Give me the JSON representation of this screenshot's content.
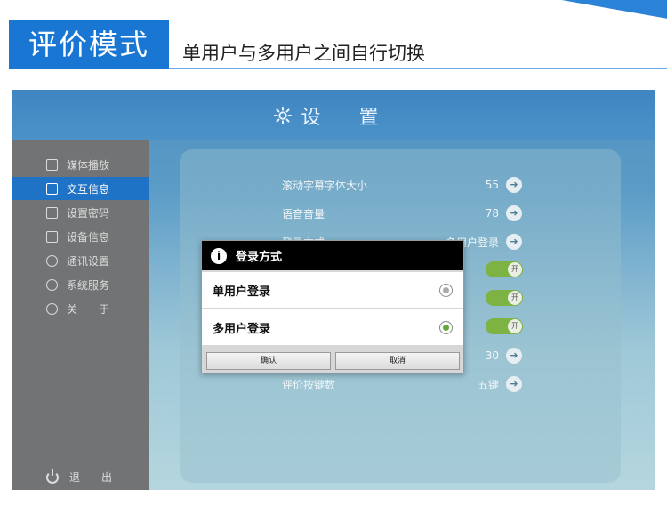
{
  "banner": {
    "title": "评价模式",
    "subtitle": "单用户与多用户之间自行切换"
  },
  "app": {
    "header_title": "设 置",
    "sidebar": {
      "items": [
        {
          "label": "媒体播放",
          "icon": "play-icon"
        },
        {
          "label": "交互信息",
          "icon": "document-icon"
        },
        {
          "label": "设置密码",
          "icon": "lock-icon"
        },
        {
          "label": "设备信息",
          "icon": "device-info-icon"
        },
        {
          "label": "通讯设置",
          "icon": "globe-icon"
        },
        {
          "label": "系统服务",
          "icon": "wrench-icon"
        },
        {
          "label": "关　　于",
          "icon": "info-icon"
        }
      ],
      "active_index": 1,
      "exit_label": "退　　出"
    },
    "settings": [
      {
        "label": "滚动字幕字体大小",
        "value": "55"
      },
      {
        "label": "语音音量",
        "value": "78"
      },
      {
        "label": "登录方式",
        "value": "多用户登录"
      },
      {
        "label": "",
        "value": "开"
      },
      {
        "label": "",
        "value": "开"
      },
      {
        "label": "",
        "value": "开"
      },
      {
        "label": "",
        "value": "30"
      },
      {
        "label": "评价按键数",
        "value": "五键"
      }
    ],
    "dialog": {
      "title": "登录方式",
      "options": [
        {
          "label": "单用户登录",
          "selected": false
        },
        {
          "label": "多用户登录",
          "selected": true
        }
      ],
      "confirm_label": "确认",
      "cancel_label": "取消"
    }
  },
  "colors": {
    "accent": "#1976d2",
    "sidebar_bg": "#717374",
    "active_item": "#1e73c7",
    "toggle_on": "#7cb342"
  }
}
